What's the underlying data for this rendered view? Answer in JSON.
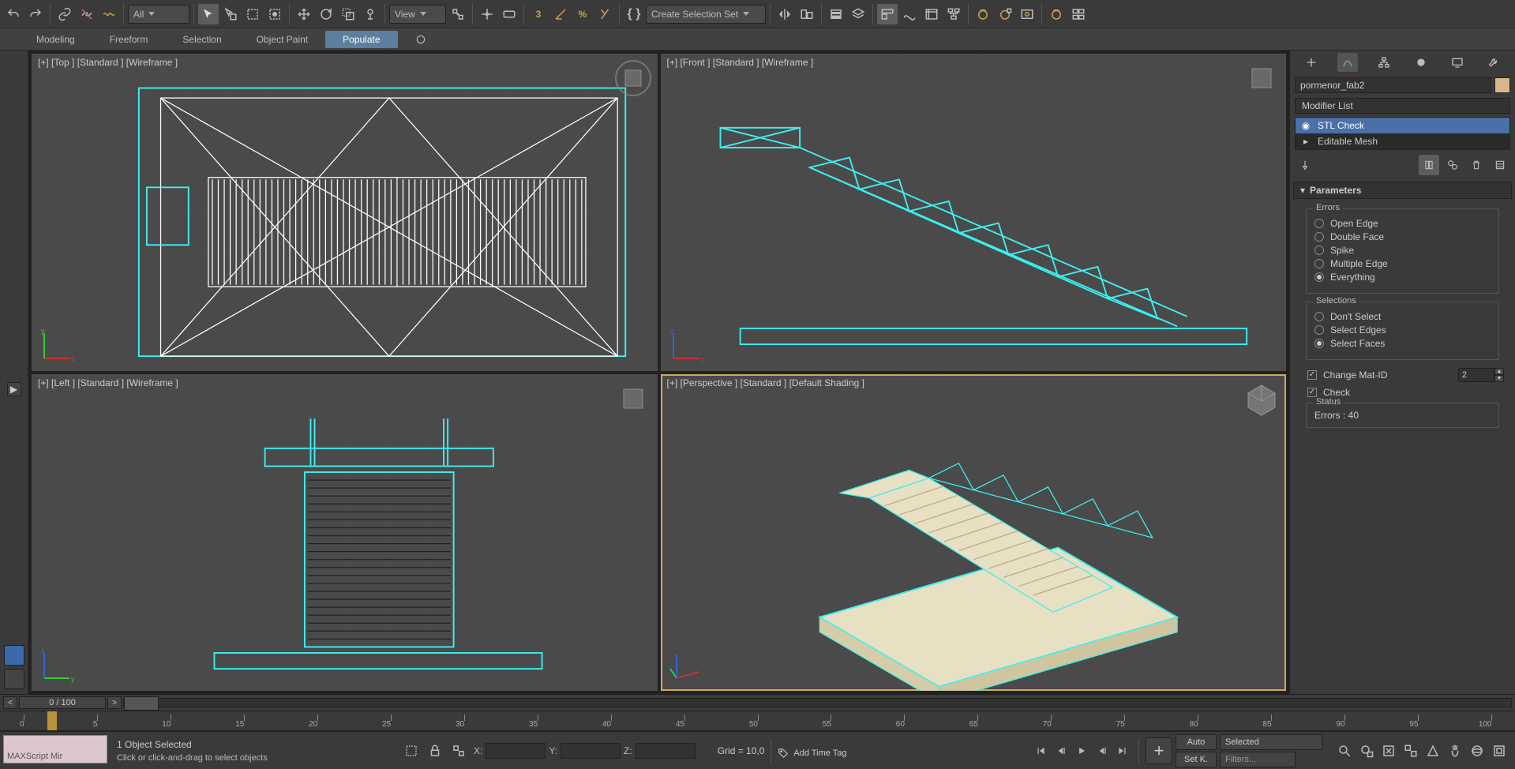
{
  "toolbar": {
    "filter_label": "All",
    "view_label": "View",
    "selset_label": "Create Selection Set"
  },
  "ribbon": {
    "tabs": [
      "Modeling",
      "Freeform",
      "Selection",
      "Object Paint",
      "Populate"
    ],
    "active": 4
  },
  "viewports": {
    "top": "[+] [Top ] [Standard ] [Wireframe ]",
    "front": "[+] [Front ] [Standard ] [Wireframe ]",
    "left": "[+] [Left ] [Standard ] [Wireframe ]",
    "persp": "[+] [Perspective ] [Standard ] [Default Shading ]"
  },
  "panel": {
    "object_name": "pormenor_fab2",
    "modlist_label": "Modifier List",
    "stack": {
      "stl": "STL Check",
      "mesh": "Editable Mesh"
    },
    "rollout_title": "Parameters",
    "errors_legend": "Errors",
    "errors_opts": [
      "Open Edge",
      "Double Face",
      "Spike",
      "Multiple Edge",
      "Everything"
    ],
    "errors_sel": 4,
    "sel_legend": "Selections",
    "sel_opts": [
      "Don't Select",
      "Select Edges",
      "Select Faces"
    ],
    "sel_sel": 2,
    "change_matid": "Change Mat-ID",
    "matid_val": "2",
    "check_label": "Check",
    "status_legend": "Status",
    "status_text": "Errors : 40"
  },
  "track": {
    "counter": "0 / 100"
  },
  "timeline_ticks": [
    0,
    5,
    10,
    15,
    20,
    25,
    30,
    35,
    40,
    45,
    50,
    55,
    60,
    65,
    70,
    75,
    80,
    85,
    90,
    95,
    100
  ],
  "status": {
    "mx1": "",
    "mx2": "MAXScript Mir",
    "sel_count": "1 Object Selected",
    "prompt": "Click or click-and-drag to select objects",
    "x": "X:",
    "y": "Y:",
    "z": "Z:",
    "grid": "Grid = 10,0",
    "auto": "Auto",
    "setk": "Set K.",
    "selected": "Selected",
    "filters": "Filters...",
    "addtag": "Add Time Tag"
  }
}
